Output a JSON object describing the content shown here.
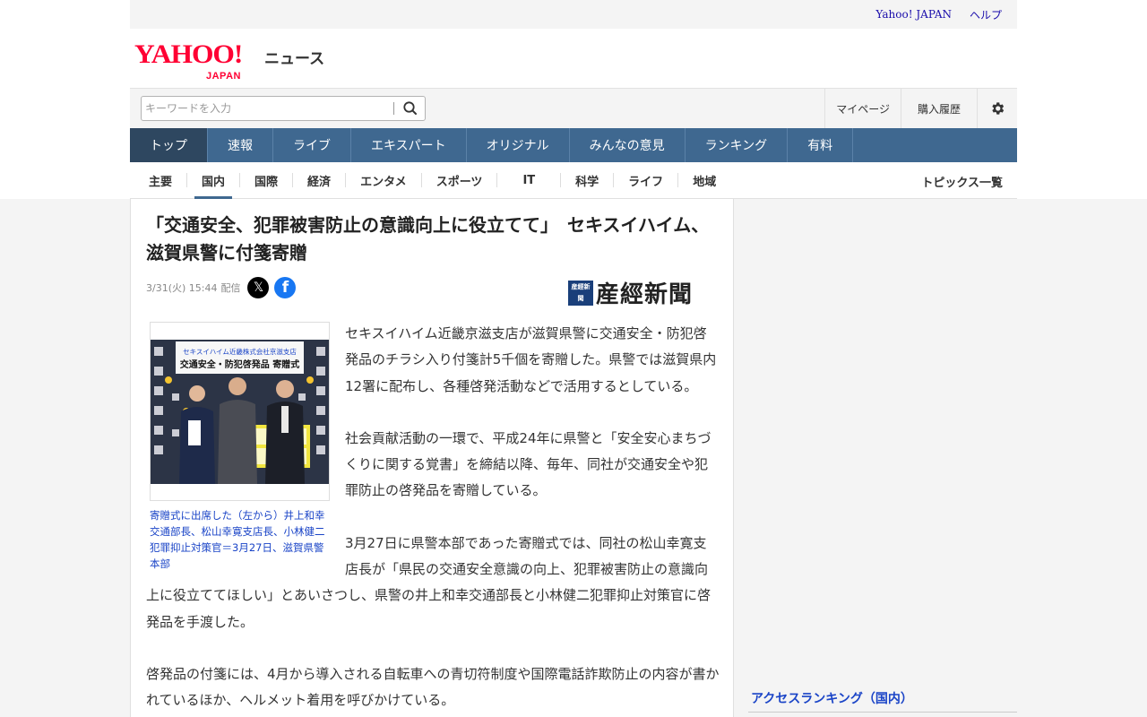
{
  "topbar": {
    "yahoo_japan": "Yahoo! JAPAN",
    "help": "ヘルプ"
  },
  "logo": {
    "main": "YAHOO!",
    "sub": "JAPAN",
    "news": "ニュース"
  },
  "search": {
    "placeholder": "キーワードを入力",
    "icon": "search-icon"
  },
  "account": {
    "mypage": "マイページ",
    "history": "購入履歴",
    "settings_icon": "gear-icon"
  },
  "main_nav": [
    "トップ",
    "速報",
    "ライブ",
    "エキスパート",
    "オリジナル",
    "みんなの意見",
    "ランキング",
    "有料"
  ],
  "sub_nav": [
    "主要",
    "国内",
    "国際",
    "経済",
    "エンタメ",
    "スポーツ",
    "IT",
    "科学",
    "ライフ",
    "地域"
  ],
  "sub_nav_active": "国内",
  "topics_all": "トピックス一覧",
  "article": {
    "title": "「交通安全、犯罪被害防止の意識向上に役立てて」　セキスイハイム、滋賀県警に付箋寄贈",
    "date": "3/31(火) 15:44",
    "delivered": "配信",
    "publisher": "産經新聞",
    "publisher_mark": [
      "産",
      "經",
      "新",
      "聞"
    ],
    "photo_banner_1": "セキスイハイム近畿株式会社京滋支店",
    "photo_banner_2": "交通安全・防犯啓発品 寄贈式",
    "caption": "寄贈式に出席した（左から）井上和幸交通部長、松山幸寛支店長、小林健二犯罪抑止対策官＝3月27日、滋賀県警本部",
    "paragraphs": [
      "セキスイハイム近畿京滋支店が滋賀県警に交通安全・防犯啓発品のチラシ入り付箋計5千個を寄贈した。県警では滋賀県内12署に配布し、各種啓発活動などで活用するとしている。",
      "社会貢献活動の一環で、平成24年に県警と「安全安心まちづくりに関する覚書」を締結以降、毎年、同社が交通安全や犯罪防止の啓発品を寄贈している。",
      "3月27日に県警本部であった寄贈式では、同社の松山幸寛支店長が「県民の交通安全意識の向上、犯罪被害防止の意識向上に役立ててほしい」とあいさつし、県警の井上和幸交通部長と小林健二犯罪抑止対策官に啓発品を手渡した。",
      "啓発品の付箋には、4月から導入される自転車への青切符制度や国際電話詐欺防止の内容が書かれているほか、ヘルメット着用を呼びかけている。"
    ]
  },
  "sidebar": {
    "ranking_title": "アクセスランキング（国内）"
  },
  "colors": {
    "nav_bg": "#3f6890",
    "nav_active": "#2e4760",
    "logo_red": "#ff0033",
    "link_blue": "#1a44c7"
  }
}
